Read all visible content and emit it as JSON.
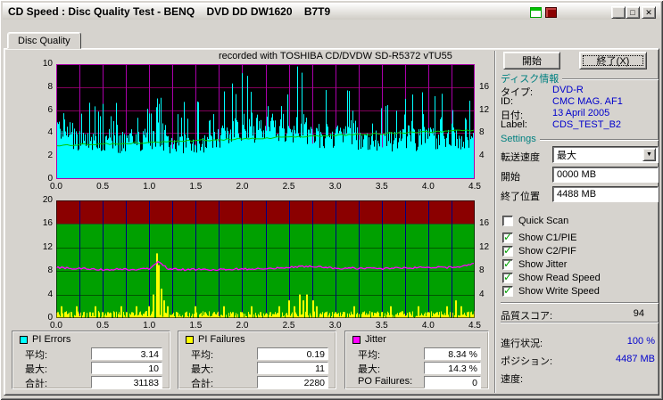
{
  "window": {
    "title": "CD Speed : Disc Quality Test - BENQ    DVD DD DW1620    B7T9",
    "controls": {
      "minimize": "_",
      "maximize": "□",
      "close": "✕"
    }
  },
  "tab": {
    "label": "Disc Quality"
  },
  "chart_data": [
    {
      "type": "area",
      "name": "pi-errors-and-read-speed",
      "title": "recorded with TOSHIBA CD/DVDW SD-R5372 vTU55",
      "x_unit": "GB",
      "x_range": [
        0,
        4.5
      ],
      "x_ticks": [
        "0.0",
        "0.5",
        "1.0",
        "1.5",
        "2.0",
        "2.5",
        "3.0",
        "3.5",
        "4.0",
        "4.5"
      ],
      "y_left": {
        "label": "PI Errors",
        "range": [
          0,
          10
        ],
        "ticks": [
          "10",
          "8",
          "6",
          "4",
          "2",
          "0"
        ]
      },
      "y_right": {
        "label": "Speed",
        "range": [
          0,
          20
        ],
        "ticks": [
          "16",
          "12",
          "8",
          "4"
        ]
      },
      "bg": "#000000",
      "grid_color_v": "#aa00aa",
      "grid_color_h": "#80005a",
      "series": [
        {
          "name": "PI Errors",
          "type": "bars",
          "axis": "left",
          "color": "#00ffff",
          "x_step": 0.1,
          "envelope": [
            9,
            9.5,
            8,
            7,
            7.5,
            7,
            6.5,
            7,
            7.5,
            7,
            8,
            8.5,
            7,
            6.5,
            7,
            7,
            6.5,
            7.5,
            8,
            9,
            10,
            10,
            9.5,
            10,
            10,
            10,
            10,
            9.5,
            8.5,
            8,
            8.5,
            8,
            7.5,
            8,
            7.5,
            7,
            7.5,
            8,
            8,
            7.5,
            8,
            7.5,
            8,
            8.5,
            7.5,
            7
          ]
        },
        {
          "name": "Read Speed",
          "type": "line",
          "axis": "right",
          "color": "#00c800",
          "x": [
            0,
            0.5,
            1,
            1.5,
            2,
            2.5,
            3,
            3.5,
            4,
            4.5
          ],
          "values": [
            5.8,
            6.1,
            6.4,
            6.7,
            7.0,
            7.3,
            7.6,
            7.9,
            8.2,
            8.5
          ]
        }
      ]
    },
    {
      "type": "area",
      "name": "jitter-and-pi-failures",
      "x_unit": "GB",
      "x_range": [
        0,
        4.5
      ],
      "x_ticks": [
        "0.0",
        "0.5",
        "1.0",
        "1.5",
        "2.0",
        "2.5",
        "3.0",
        "3.5",
        "4.0",
        "4.5"
      ],
      "y_left": {
        "label": "",
        "range": [
          0,
          20
        ],
        "ticks": [
          "20",
          "16",
          "12",
          "8",
          "4",
          "0"
        ]
      },
      "y_right": {
        "label": "",
        "range": [
          0,
          20
        ],
        "ticks": [
          "16",
          "12",
          "8",
          "4"
        ]
      },
      "bg": "#00a000",
      "band": {
        "from": 16,
        "to": 20,
        "color": "#8b0000"
      },
      "grid_color_v": "#000080",
      "grid_color_h": "rgba(0,0,0,0.45)",
      "series": [
        {
          "name": "PI Failures",
          "type": "bars",
          "axis": "left",
          "color": "#ffff00",
          "points": [
            [
              0.02,
              1
            ],
            [
              0.06,
              2
            ],
            [
              0.1,
              1
            ],
            [
              0.16,
              1
            ],
            [
              0.22,
              2
            ],
            [
              0.3,
              1
            ],
            [
              0.36,
              1
            ],
            [
              0.42,
              2
            ],
            [
              0.5,
              1
            ],
            [
              0.56,
              1
            ],
            [
              0.62,
              1
            ],
            [
              0.7,
              2
            ],
            [
              0.76,
              1
            ],
            [
              0.82,
              1
            ],
            [
              0.86,
              2
            ],
            [
              0.9,
              1
            ],
            [
              0.96,
              1
            ],
            [
              1.0,
              2
            ],
            [
              1.05,
              4
            ],
            [
              1.08,
              11
            ],
            [
              1.1,
              9
            ],
            [
              1.13,
              5
            ],
            [
              1.16,
              3
            ],
            [
              1.2,
              2
            ],
            [
              1.3,
              1
            ],
            [
              1.4,
              1
            ],
            [
              1.5,
              2
            ],
            [
              1.6,
              1
            ],
            [
              1.7,
              1
            ],
            [
              1.8,
              2
            ],
            [
              1.9,
              1
            ],
            [
              2.0,
              1
            ],
            [
              2.1,
              2
            ],
            [
              2.2,
              1
            ],
            [
              2.3,
              1
            ],
            [
              2.4,
              2
            ],
            [
              2.5,
              3
            ],
            [
              2.56,
              2
            ],
            [
              2.62,
              4
            ],
            [
              2.66,
              3
            ],
            [
              2.7,
              4
            ],
            [
              2.76,
              3
            ],
            [
              2.8,
              2
            ],
            [
              2.9,
              1
            ],
            [
              3.0,
              1
            ],
            [
              3.1,
              1
            ],
            [
              3.2,
              2
            ],
            [
              3.3,
              1
            ],
            [
              3.4,
              1
            ],
            [
              3.5,
              1
            ],
            [
              3.6,
              2
            ],
            [
              3.7,
              1
            ],
            [
              3.8,
              1
            ],
            [
              3.9,
              2
            ],
            [
              4.0,
              1
            ],
            [
              4.1,
              1
            ],
            [
              4.2,
              2
            ],
            [
              4.3,
              3
            ],
            [
              4.36,
              2
            ],
            [
              4.42,
              1
            ],
            [
              4.46,
              1
            ]
          ]
        },
        {
          "name": "Jitter",
          "type": "line",
          "axis": "left",
          "color": "#ff00ff",
          "x_step": 0.1,
          "values": [
            8.6,
            8.5,
            8.4,
            8.4,
            8.3,
            8.2,
            8.3,
            8.3,
            8.2,
            8.3,
            8.4,
            9.6,
            8.4,
            8.3,
            8.2,
            8.3,
            8.3,
            8.2,
            8.3,
            8.3,
            8.4,
            8.3,
            8.4,
            8.4,
            8.5,
            8.6,
            8.7,
            8.8,
            8.7,
            8.6,
            8.5,
            8.4,
            8.5,
            8.4,
            8.5,
            8.4,
            8.5,
            8.6,
            8.5,
            8.6,
            8.6,
            8.7,
            8.6,
            8.7,
            8.9,
            9.4
          ]
        }
      ]
    }
  ],
  "legend_stats": {
    "pi_errors": {
      "title": "PI Errors",
      "color": "#00ffff",
      "rows": [
        {
          "label": "平均:",
          "value": "3.14"
        },
        {
          "label": "最大:",
          "value": "10"
        },
        {
          "label": "合計:",
          "value": "31183"
        }
      ]
    },
    "pi_failures": {
      "title": "PI Failures",
      "color": "#ffff00",
      "rows": [
        {
          "label": "平均:",
          "value": "0.19"
        },
        {
          "label": "最大:",
          "value": "11"
        },
        {
          "label": "合計:",
          "value": "2280"
        }
      ]
    },
    "jitter": {
      "title": "Jitter",
      "color": "#ff00ff",
      "rows": [
        {
          "label": "平均:",
          "value": "8.34 %"
        },
        {
          "label": "最大:",
          "value": "14.3 %"
        },
        {
          "label": "PO Failures:",
          "value": "0"
        }
      ]
    }
  },
  "panel": {
    "start_button": "開始",
    "exit_button": "終了(X)",
    "disc_info": {
      "title": "ディスク情報",
      "rows": [
        {
          "label": "タイプ:",
          "value": "DVD-R"
        },
        {
          "label": "ID:",
          "value": "CMC MAG. AF1"
        },
        {
          "label": "日付:",
          "value": "13 April 2005"
        },
        {
          "label": "Label:",
          "value": "CDS_TEST_B2"
        }
      ]
    },
    "settings": {
      "title": "Settings",
      "speed_label": "転送速度",
      "speed_value": "最大",
      "start_label": "開始",
      "start_value": "0000 MB",
      "end_label": "終了位置",
      "end_value": "4488 MB",
      "checkboxes": [
        {
          "label": "Quick Scan",
          "checked": false
        },
        {
          "label": "Show C1/PIE",
          "checked": true
        },
        {
          "label": "Show C2/PIF",
          "checked": true
        },
        {
          "label": "Show Jitter",
          "checked": true
        },
        {
          "label": "Show Read Speed",
          "checked": true
        },
        {
          "label": "Show Write Speed",
          "checked": true
        }
      ]
    },
    "quality_score": {
      "label": "品質スコア:",
      "value": "94"
    },
    "progress": {
      "label": "進行状況:",
      "value": "100 %"
    },
    "position": {
      "label": "ポジション:",
      "value": "4487 MB"
    },
    "speed": {
      "label": "速度:",
      "value": ""
    }
  },
  "icons": {
    "dropdown_arrow": "▼"
  }
}
